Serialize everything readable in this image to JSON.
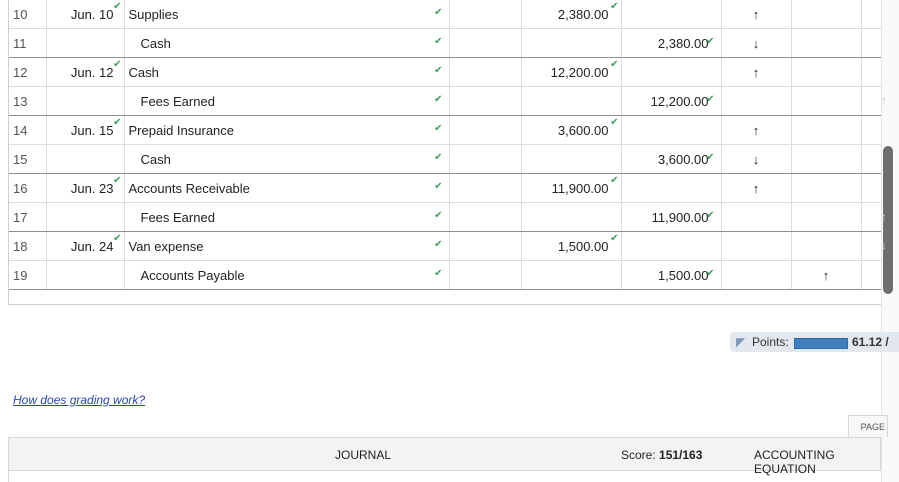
{
  "journal": {
    "rows": [
      {
        "num": "10",
        "date": "Jun. 10",
        "account": "Supplies",
        "debit": "2,380.00",
        "credit": "",
        "arrow1": "↑",
        "arrow2": ""
      },
      {
        "num": "11",
        "date": "",
        "account": "Cash",
        "debit": "",
        "credit": "2,380.00",
        "arrow1": "↓",
        "arrow2": ""
      },
      {
        "num": "12",
        "date": "Jun. 12",
        "account": "Cash",
        "debit": "12,200.00",
        "credit": "",
        "arrow1": "↑",
        "arrow2": ""
      },
      {
        "num": "13",
        "date": "",
        "account": "Fees Earned",
        "debit": "",
        "credit": "12,200.00",
        "arrow1": "",
        "arrow2": ""
      },
      {
        "num": "14",
        "date": "Jun. 15",
        "account": "Prepaid Insurance",
        "debit": "3,600.00",
        "credit": "",
        "arrow1": "↑",
        "arrow2": ""
      },
      {
        "num": "15",
        "date": "",
        "account": "Cash",
        "debit": "",
        "credit": "3,600.00",
        "arrow1": "↓",
        "arrow2": ""
      },
      {
        "num": "16",
        "date": "Jun. 23",
        "account": "Accounts Receivable",
        "debit": "11,900.00",
        "credit": "",
        "arrow1": "↑",
        "arrow2": ""
      },
      {
        "num": "17",
        "date": "",
        "account": "Fees Earned",
        "debit": "",
        "credit": "11,900.00",
        "arrow1": "",
        "arrow2": ""
      },
      {
        "num": "18",
        "date": "Jun. 24",
        "account": "Van expense",
        "debit": "1,500.00",
        "credit": "",
        "arrow1": "",
        "arrow2": ""
      },
      {
        "num": "19",
        "date": "",
        "account": "Accounts Payable",
        "debit": "",
        "credit": "1,500.00",
        "arrow1": "",
        "arrow2": "↑"
      }
    ]
  },
  "points": {
    "label": "Points:",
    "value": "61.12 /",
    "fill_fraction": 0.8
  },
  "grading_link": "How does grading work?",
  "page_tab": "PAGE",
  "tabs": {
    "journal": "JOURNAL",
    "score_label": "Score:",
    "score_value": "151/163",
    "accounting_equation": "ACCOUNTING EQUATION"
  },
  "colors": {
    "check": "#3aa05a",
    "points_bar": "#3f7fc0",
    "link": "#2747b3"
  }
}
